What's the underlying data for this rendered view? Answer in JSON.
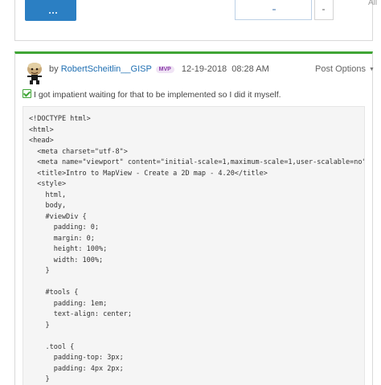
{
  "header": {
    "corner_label": "All"
  },
  "post": {
    "by_label": "by",
    "author": "RobertScheitlin__GISP",
    "badge": "MVP",
    "date": "12-19-2018",
    "time": "08:28 AM",
    "options_label": "Post Options",
    "message": "I got impatient waiting for that to be implemented so I did it myself.",
    "code_lines": [
      "<!DOCTYPE html>",
      "<html>",
      "<head>",
      "  <meta charset=\"utf-8\">",
      "  <meta name=\"viewport\" content=\"initial-scale=1,maximum-scale=1,user-scalable=no\">",
      "  <title>Intro to MapView - Create a 2D map - 4.20</title>",
      "  <style>",
      "    html,",
      "    body,",
      "    #viewDiv {",
      "      padding: 0;",
      "      margin: 0;",
      "      height: 100%;",
      "      width: 100%;",
      "    }",
      "",
      "    #tools {",
      "      padding: 1em;",
      "      text-align: center;",
      "    }",
      "",
      "    .tool {",
      "      padding-top: 3px;",
      "      padding: 4px 2px;",
      "    }"
    ]
  },
  "colors": {
    "accent_green": "#3fa535",
    "link_blue": "#1f6fb2",
    "button_blue": "#2b7fc3",
    "mvp_purple": "#8a3aa8"
  },
  "icons": {
    "avatar": "user-avatar",
    "check": "checkbox-checked-icon",
    "options_caret": "caret-down-icon"
  }
}
